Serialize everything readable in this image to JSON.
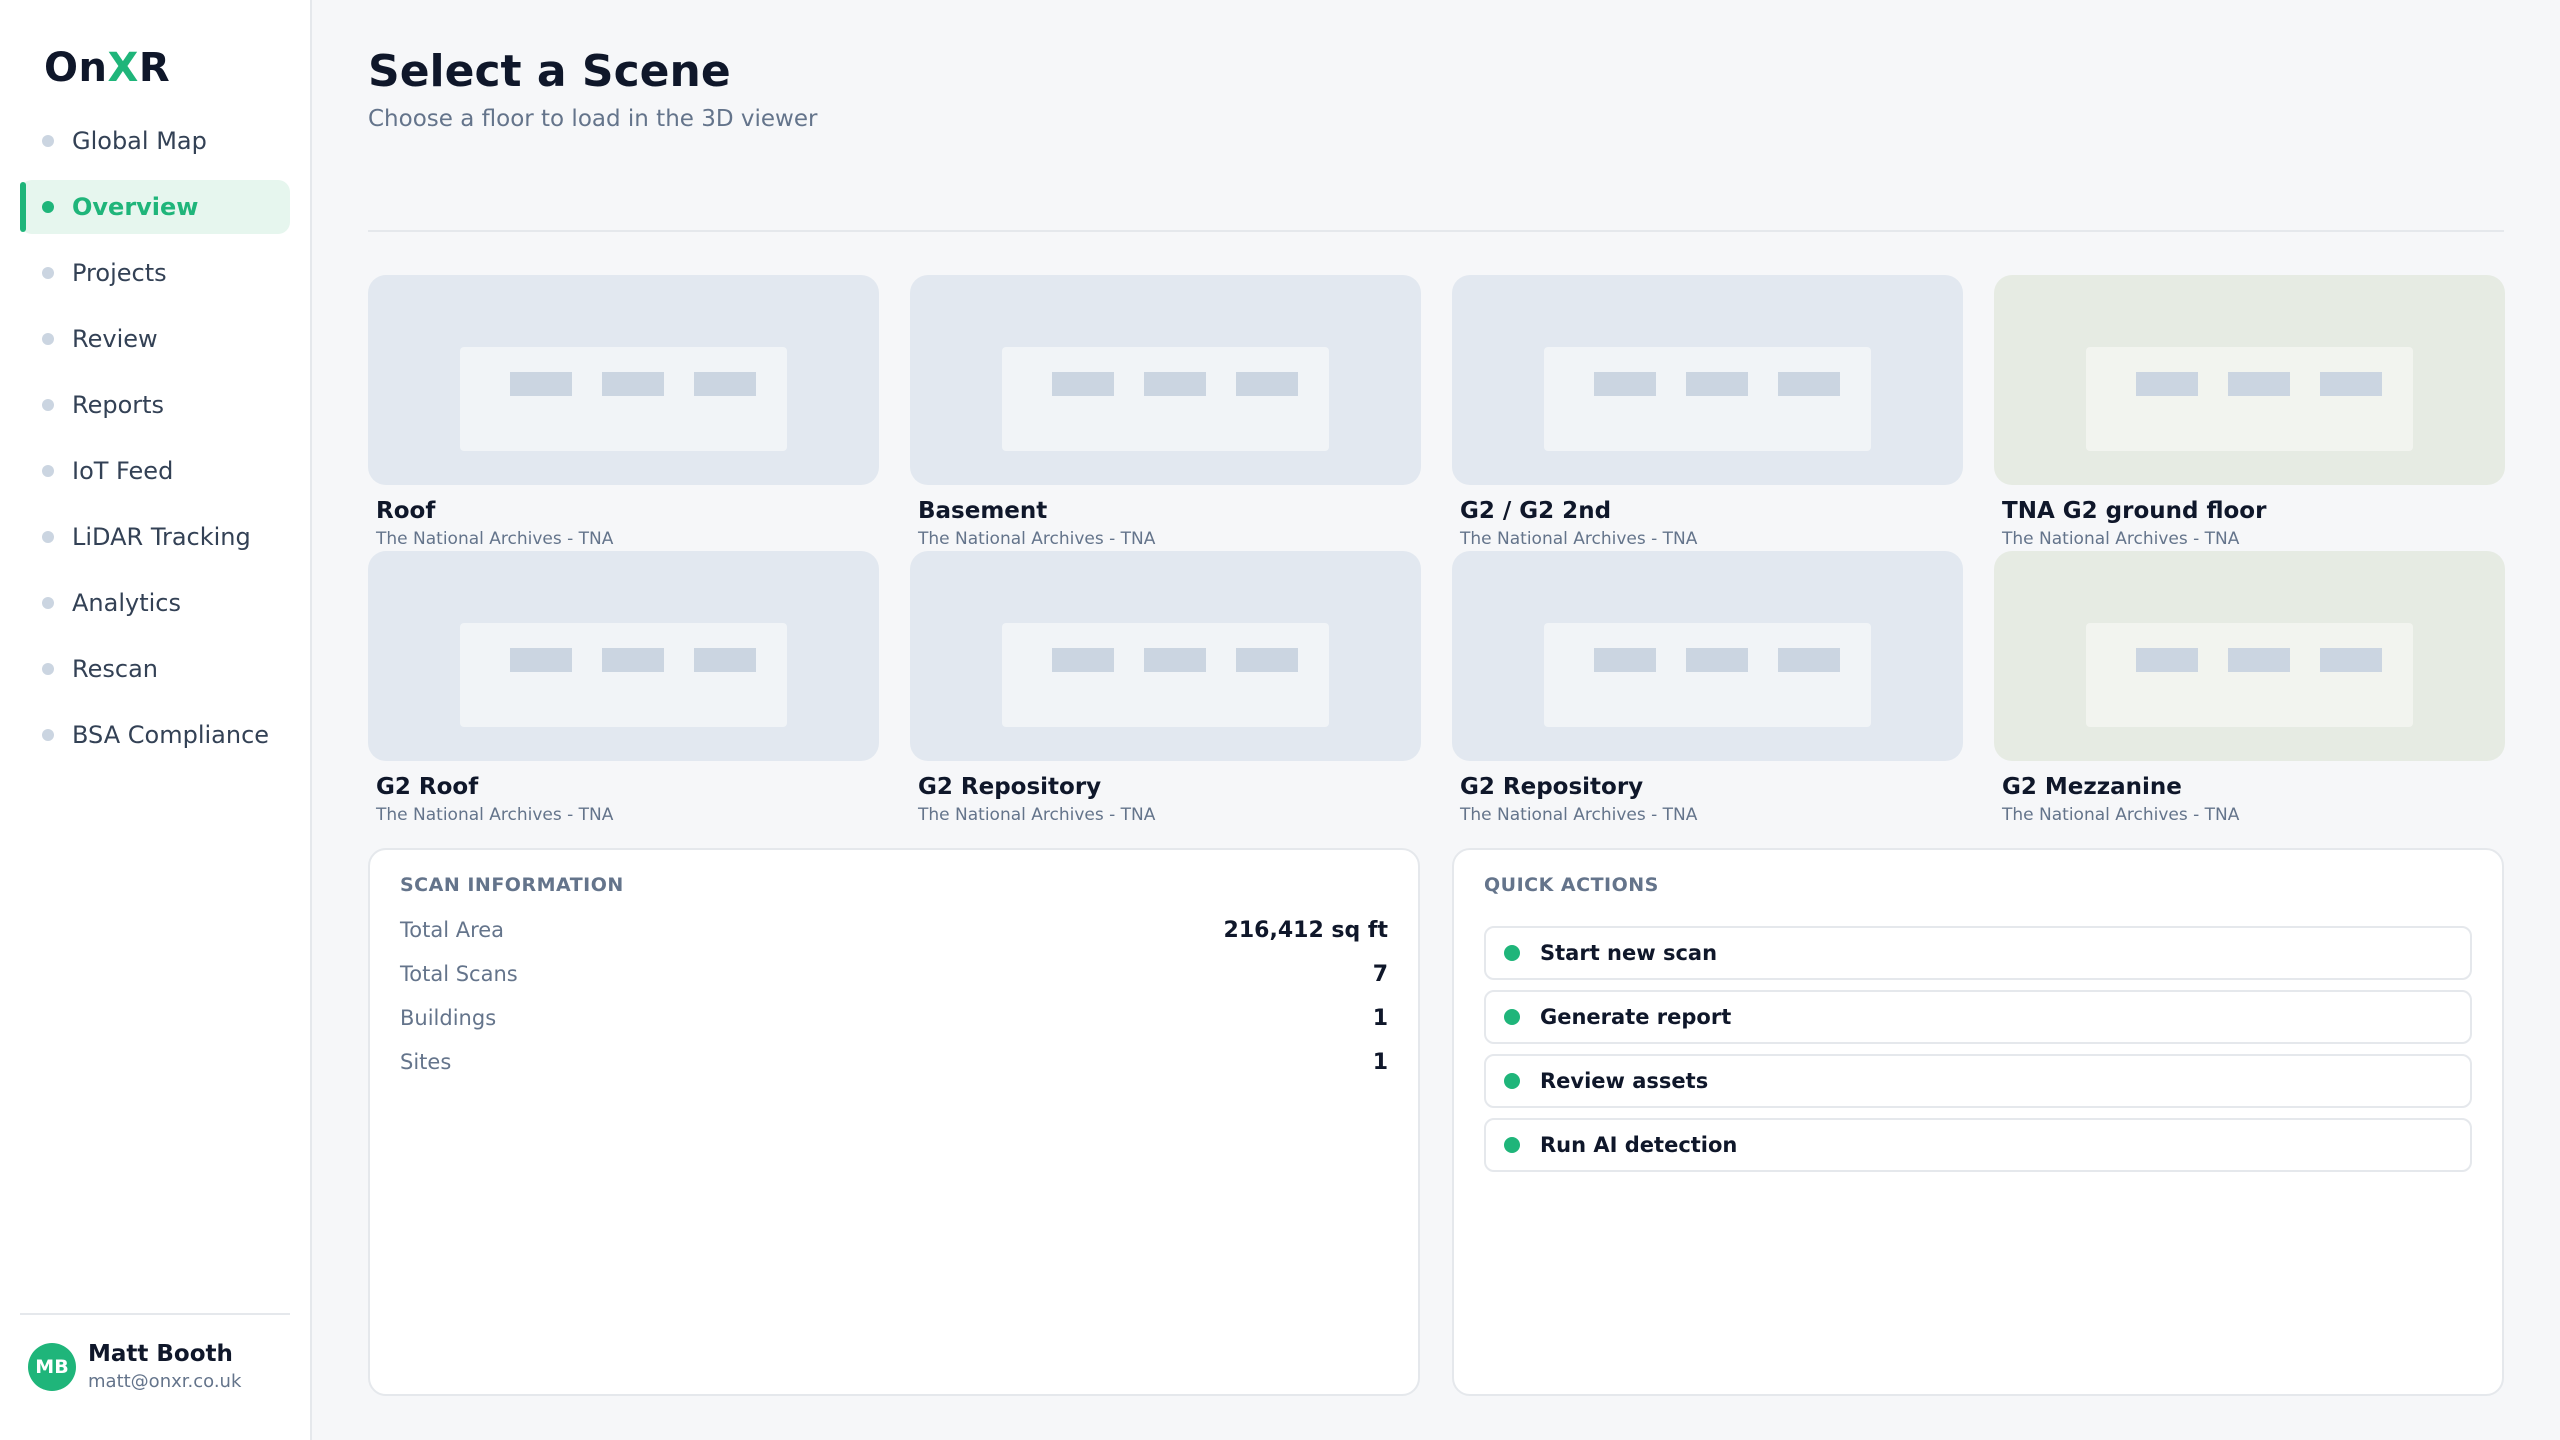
{
  "brand": {
    "prefix": "On",
    "accent": "X",
    "suffix": "R",
    "accent_color": "#1fb57a"
  },
  "sidebar": {
    "items": [
      {
        "label": "Global Map",
        "active": false
      },
      {
        "label": "Overview",
        "active": true
      },
      {
        "label": "Projects",
        "active": false
      },
      {
        "label": "Review",
        "active": false
      },
      {
        "label": "Reports",
        "active": false
      },
      {
        "label": "IoT Feed",
        "active": false
      },
      {
        "label": "LiDAR Tracking",
        "active": false
      },
      {
        "label": "Analytics",
        "active": false
      },
      {
        "label": "Rescan",
        "active": false
      },
      {
        "label": "BSA Compliance",
        "active": false
      }
    ],
    "user": {
      "initials": "MB",
      "name": "Matt Booth",
      "email": "matt@onxr.co.uk"
    }
  },
  "header": {
    "title": "Select a Scene",
    "subtitle": "Choose a floor to load in the 3D viewer"
  },
  "scenes": [
    {
      "name": "Roof",
      "site": "The National Archives - TNA",
      "thumb_style": "blue"
    },
    {
      "name": "Basement",
      "site": "The National Archives - TNA",
      "thumb_style": "blue"
    },
    {
      "name": "G2 / G2 2nd",
      "site": "The National Archives - TNA",
      "thumb_style": "blue"
    },
    {
      "name": "TNA G2 ground floor",
      "site": "The National Archives - TNA",
      "thumb_style": "green"
    },
    {
      "name": "G2 Roof",
      "site": "The National Archives - TNA",
      "thumb_style": "blue"
    },
    {
      "name": "G2 Repository",
      "site": "The National Archives - TNA",
      "thumb_style": "blue"
    },
    {
      "name": "G2 Repository",
      "site": "The National Archives - TNA",
      "thumb_style": "blue"
    },
    {
      "name": "G2 Mezzanine",
      "site": "The National Archives - TNA",
      "thumb_style": "green"
    }
  ],
  "scan_info": {
    "title": "SCAN INFORMATION",
    "rows": [
      {
        "label": "Total Area",
        "value": "216,412 sq ft"
      },
      {
        "label": "Total Scans",
        "value": "7"
      },
      {
        "label": "Buildings",
        "value": "1"
      },
      {
        "label": "Sites",
        "value": "1"
      }
    ]
  },
  "quick_actions": {
    "title": "QUICK ACTIONS",
    "items": [
      {
        "label": "Start new scan"
      },
      {
        "label": "Generate report"
      },
      {
        "label": "Review assets"
      },
      {
        "label": "Run AI detection"
      }
    ]
  }
}
